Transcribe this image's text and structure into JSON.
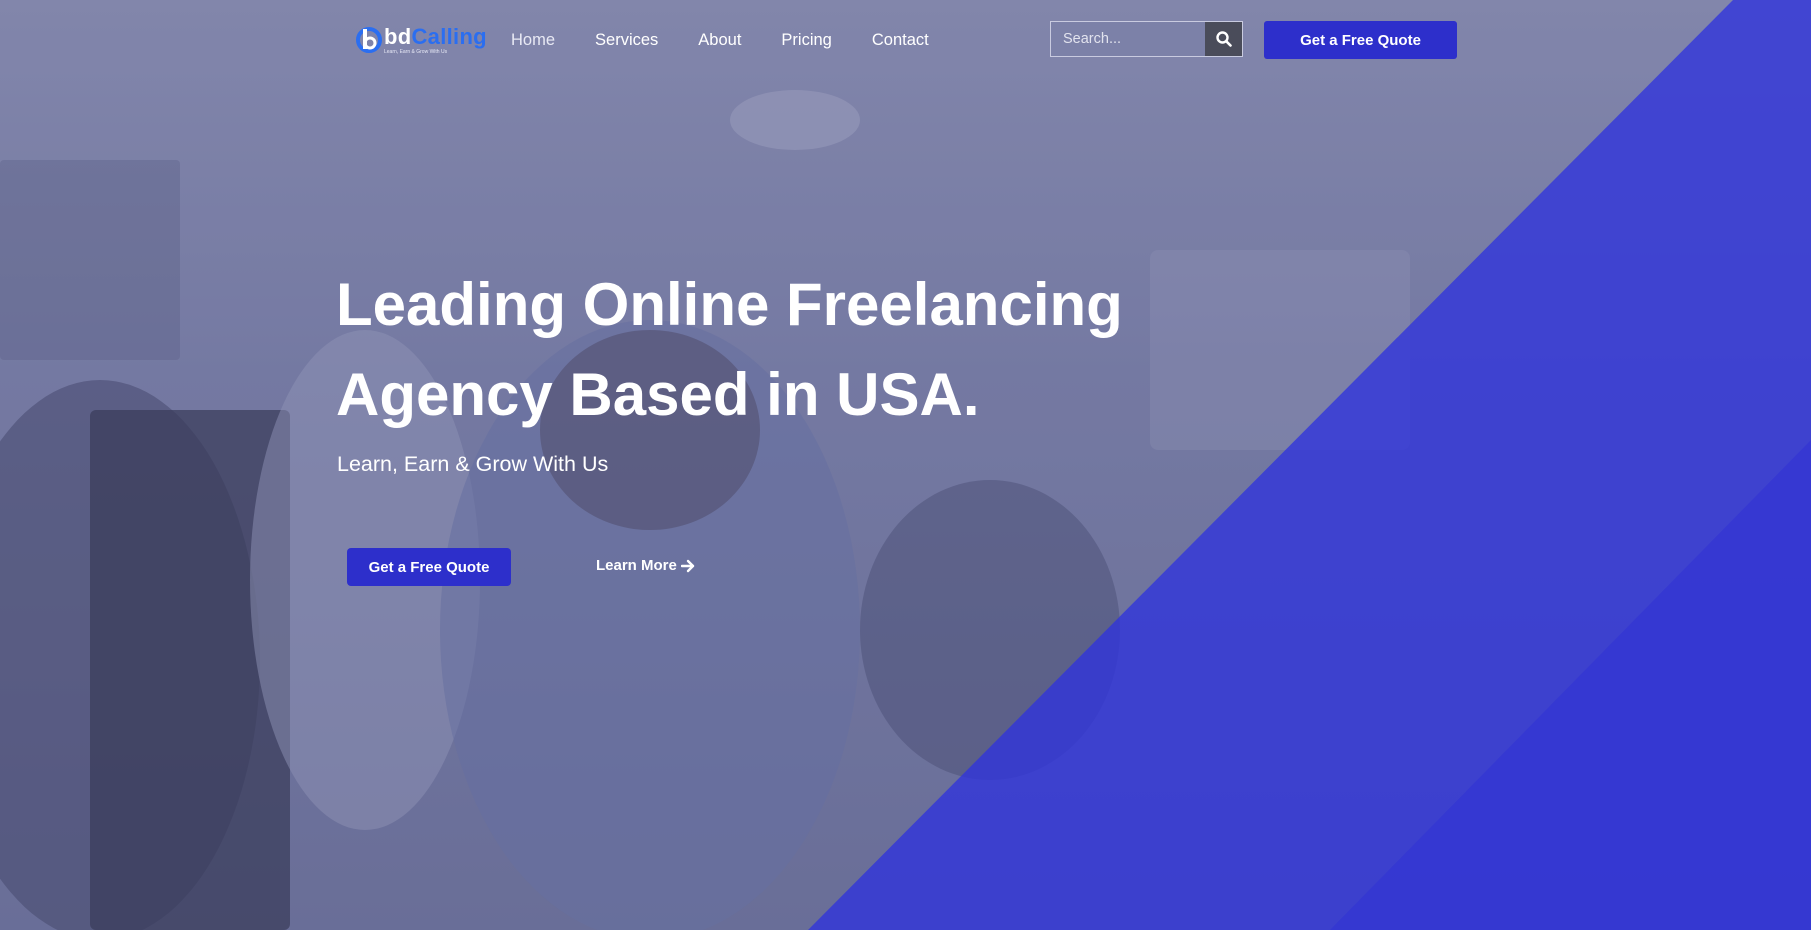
{
  "brand": {
    "name_part1": "bd",
    "name_part2": "Calling",
    "tagline": "Learn, Earn & Grow With Us",
    "accent_color": "#2b6ef0"
  },
  "nav": {
    "links": [
      "Home",
      "Services",
      "About",
      "Pricing",
      "Contact"
    ]
  },
  "search": {
    "placeholder": "Search...",
    "icon": "search-icon"
  },
  "header_cta": {
    "label": "Get a Free Quote"
  },
  "hero": {
    "headline_line1": "Leading Online Freelancing",
    "headline_line2": "Agency Based in USA.",
    "subheadline": "Learn, Earn & Grow With Us",
    "primary_cta": "Get a Free Quote",
    "secondary_cta": "Learn More",
    "secondary_icon": "arrow-right-icon"
  },
  "colors": {
    "primary": "#2d2fcb",
    "diagonal_overlay": "#3235dc",
    "search_button": "#4a4c5a"
  }
}
